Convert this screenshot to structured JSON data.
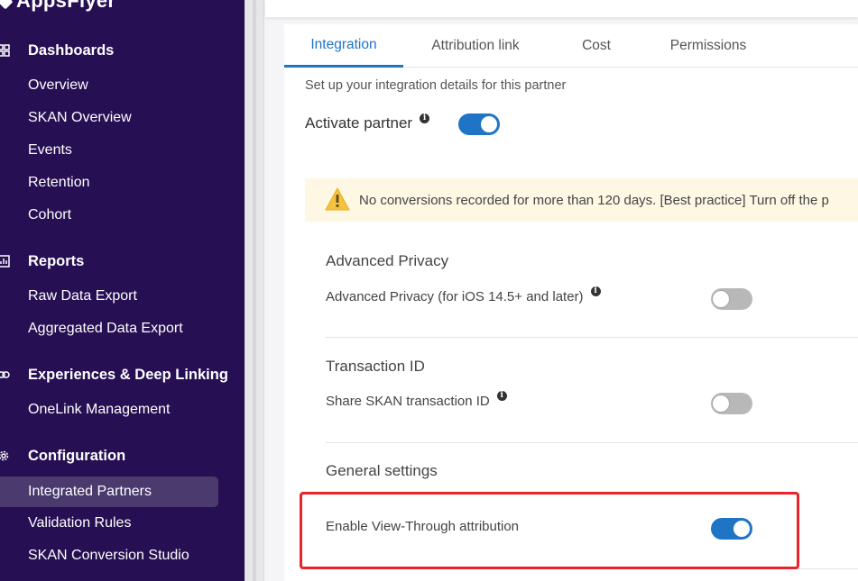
{
  "app": {
    "logo": "AppsFlyer"
  },
  "sidebar": {
    "sections": [
      {
        "label": "Dashboards",
        "icon": "dashboard-icon"
      },
      {
        "label": "Reports",
        "icon": "chart-icon"
      },
      {
        "label": "Experiences & Deep Linking",
        "icon": "link-icon"
      },
      {
        "label": "Configuration",
        "icon": "gear-icon"
      }
    ],
    "items": [
      {
        "label": "Overview"
      },
      {
        "label": "SKAN Overview"
      },
      {
        "label": "Events"
      },
      {
        "label": "Retention"
      },
      {
        "label": "Cohort"
      },
      {
        "label": "Raw Data Export"
      },
      {
        "label": "Aggregated Data Export"
      },
      {
        "label": "OneLink Management"
      },
      {
        "label": "Integrated Partners",
        "active": true
      },
      {
        "label": "Validation Rules"
      },
      {
        "label": "SKAN Conversion Studio"
      }
    ]
  },
  "tabs": [
    {
      "label": "Integration",
      "active": true
    },
    {
      "label": "Attribution link"
    },
    {
      "label": "Cost"
    },
    {
      "label": "Permissions"
    }
  ],
  "integration": {
    "subtitle": "Set up your integration details for this partner",
    "activate_label": "Activate partner",
    "activate_on": true,
    "warning": "No conversions recorded for more than 120 days. [Best practice] Turn off the p",
    "advanced_privacy": {
      "title": "Advanced Privacy",
      "label": "Advanced Privacy (for iOS 14.5+ and later)",
      "on": false
    },
    "transaction_id": {
      "title": "Transaction ID",
      "label": "Share SKAN transaction ID",
      "on": false
    },
    "general": {
      "title": "General settings",
      "label": "Enable View-Through attribution",
      "on": true
    }
  },
  "colors": {
    "sidebar": "#260f52",
    "accent": "#1f74c6",
    "highlight": "#e8242a",
    "warning_bg": "#fdf7e3"
  }
}
